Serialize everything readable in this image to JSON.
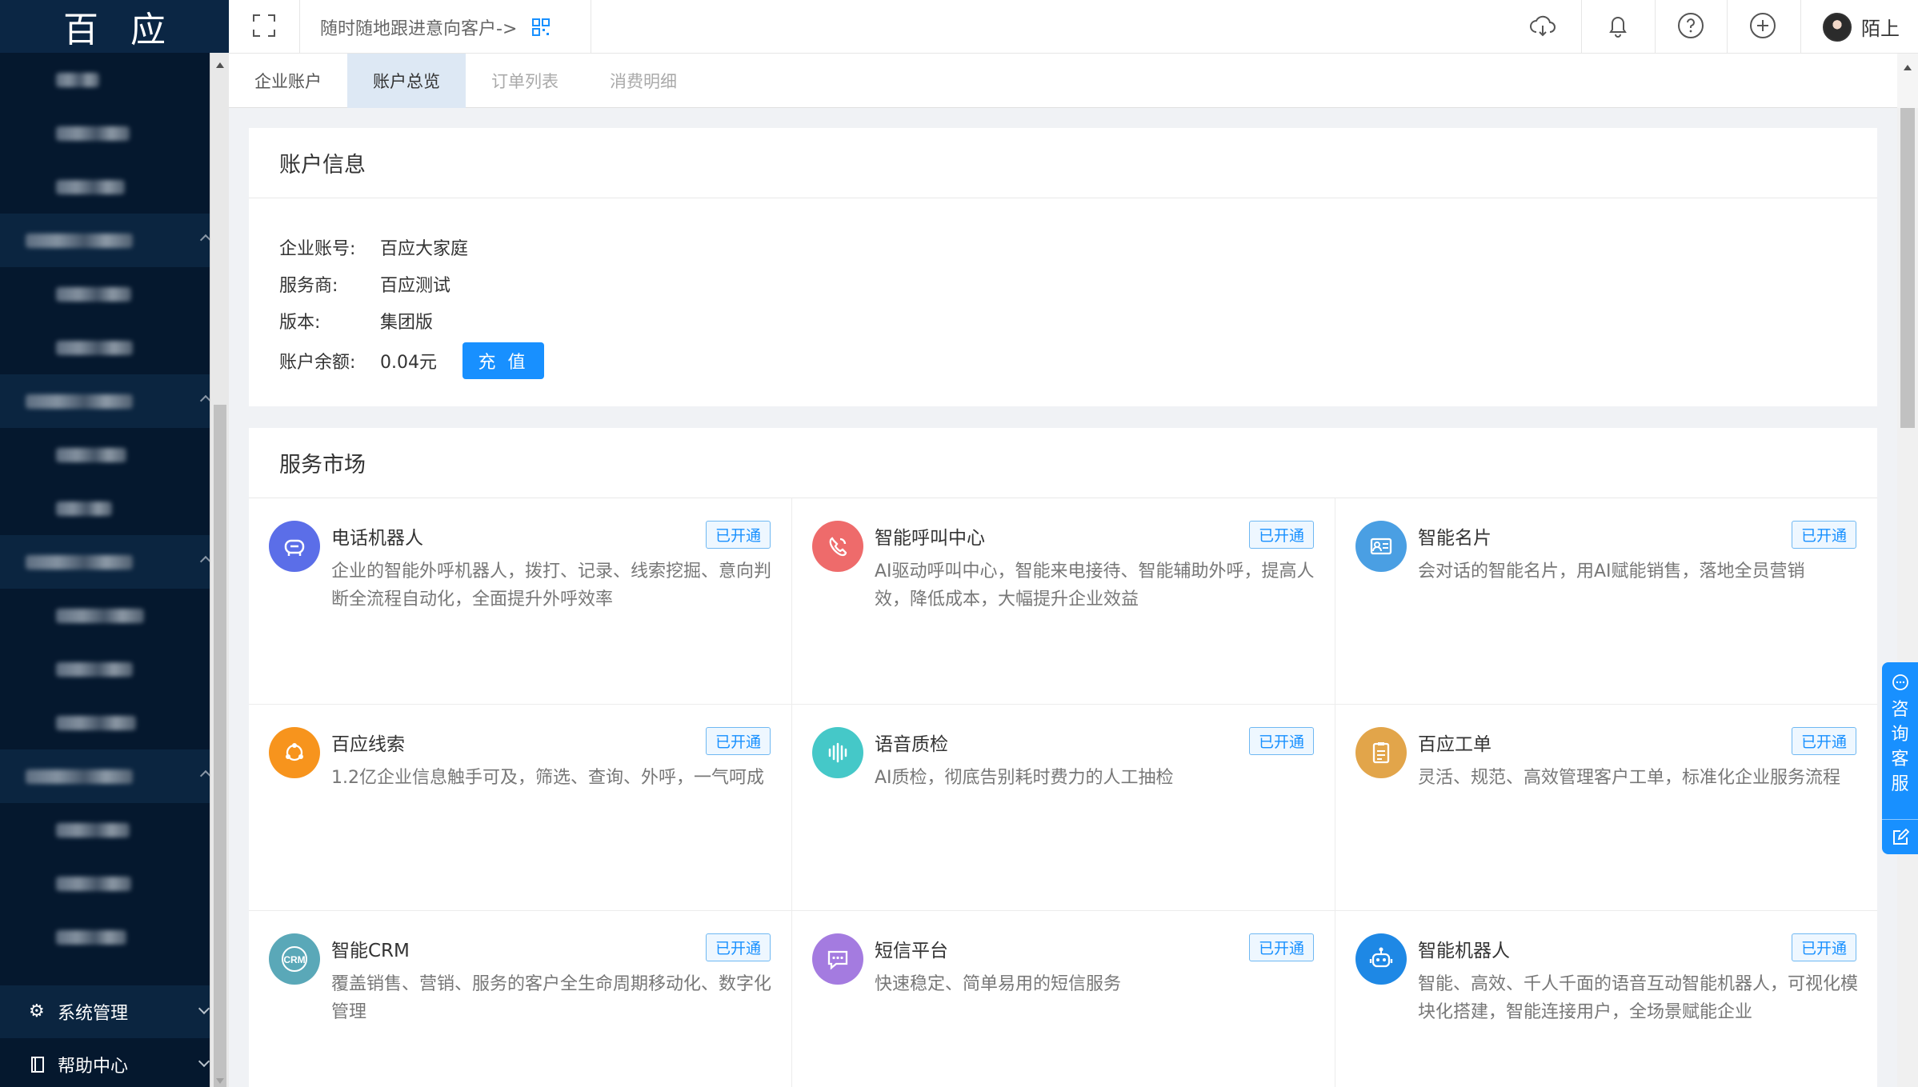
{
  "logo": {
    "left": "百",
    "right": "应"
  },
  "header": {
    "follow_text": "随时随地跟进意向客户->",
    "user_name": "陌上"
  },
  "tabs": [
    "企业账户",
    "账户总览",
    "订单列表",
    "消费明细"
  ],
  "sidebar": {
    "system_label": "系统管理",
    "help_label": "帮助中心"
  },
  "account": {
    "title": "账户信息",
    "rows": [
      {
        "label": "企业账号:",
        "value": "百应大家庭"
      },
      {
        "label": "服务商:",
        "value": "百应测试"
      },
      {
        "label": "版本:",
        "value": "集团版"
      },
      {
        "label": "账户余额:",
        "value": "0.04元"
      }
    ],
    "recharge_label": "充 值"
  },
  "market": {
    "title": "服务市场",
    "badge": "已开通",
    "items": [
      {
        "title": "电话机器人",
        "desc": "企业的智能外呼机器人，拨打、记录、线索挖掘、意向判断全流程自动化，全面提升外呼效率",
        "icon": "robot-phone-icon",
        "color": "#5b6ee8"
      },
      {
        "title": "智能呼叫中心",
        "desc": "AI驱动呼叫中心，智能来电接待、智能辅助外呼，提高人效，降低成本，大幅提升企业效益",
        "icon": "phone-icon",
        "color": "#ee6b6b"
      },
      {
        "title": "智能名片",
        "desc": "会对话的智能名片，用AI赋能销售，落地全员营销",
        "icon": "card-icon",
        "color": "#4a9fe3"
      },
      {
        "title": "百应线索",
        "desc": "1.2亿企业信息触手可及，筛选、查询、外呼，一气呵成",
        "icon": "leads-icon",
        "color": "#f7941d"
      },
      {
        "title": "语音质检",
        "desc": "AI质检，彻底告别耗时费力的人工抽检",
        "icon": "voice-wave-icon",
        "color": "#45c8c8"
      },
      {
        "title": "百应工单",
        "desc": "灵活、规范、高效管理客户工单，标准化企业服务流程",
        "icon": "ticket-icon",
        "color": "#e2a54a"
      },
      {
        "title": "智能CRM",
        "desc": "覆盖销售、营销、服务的客户全生命周期移动化、数字化管理",
        "icon": "crm-icon",
        "color": "#5aa8b8"
      },
      {
        "title": "短信平台",
        "desc": "快速稳定、简单易用的短信服务",
        "icon": "sms-icon",
        "color": "#a47be0"
      },
      {
        "title": "智能机器人",
        "desc": "智能、高效、千人千面的语音互动智能机器人，可视化模块化搭建，智能连接用户，全场景赋能企业",
        "icon": "bot-icon",
        "color": "#1e88e5"
      }
    ]
  },
  "consult": {
    "label": "咨询客服"
  },
  "colors": {
    "sidebar": "#05182e",
    "primary": "#1890ff",
    "active_tab": "#dde8f4"
  }
}
